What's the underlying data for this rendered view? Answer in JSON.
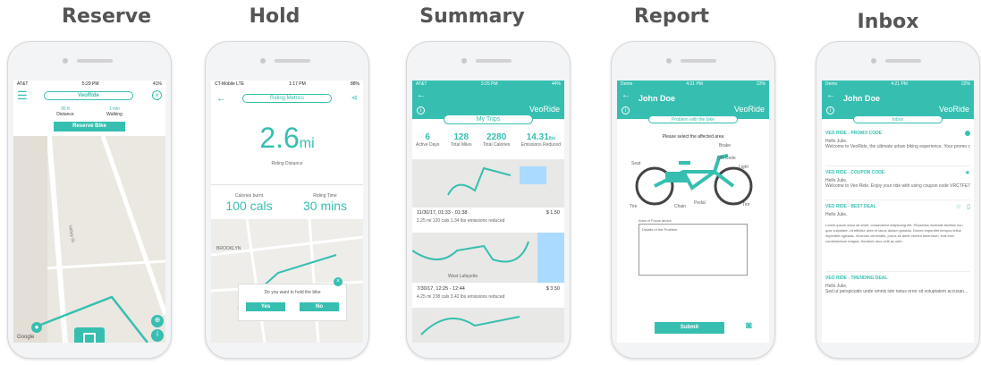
{
  "titles": {
    "reserve": "Reserve",
    "hold": "Hold",
    "summary": "Summary",
    "report": "Report",
    "inbox": "Inbox"
  },
  "reserve": {
    "carrier": "AT&T",
    "time": "5:29 PM",
    "battery": "41%",
    "app": "VeoRide",
    "distance": "95 ft",
    "distance_label": "Distance",
    "walking": "1 min",
    "walking_label": "Walking",
    "button": "Reserve Bike",
    "street": "Valley St",
    "google": "Google"
  },
  "hold": {
    "carrier": "CT-Mobile LTE",
    "time": "1:17 PM",
    "battery": "88%",
    "header": "Riding Metrics",
    "value": "2.6",
    "unit": "mi",
    "label": "Riding Distance",
    "cal_label": "Calories burnt",
    "cal": "100 cals",
    "time_label": "Riding Time",
    "ride_time": "30 mins",
    "place": "BROOKLYN",
    "prompt": "Do you want to hold the bike",
    "yes": "Yes",
    "no": "No"
  },
  "summary": {
    "carrier": "AT&T",
    "time": "3:25 PM",
    "battery": "44%",
    "brand": "VeoRide",
    "tab": "My Trips",
    "stats": [
      {
        "v": "6",
        "l": "Active Days"
      },
      {
        "v": "128",
        "l": "Total Miles"
      },
      {
        "v": "2280",
        "l": "Total Calories"
      },
      {
        "v": "14.31",
        "u": "lbs",
        "l": "Emissions Reduced"
      }
    ],
    "trips": [
      {
        "date": "11/30/17, 01:33 - 01:38",
        "price": "$ 1.50",
        "detail": "2.25 mi   120 cals   1.34 lbs emissions reduced"
      },
      {
        "date": "7/30/17, 12:25 - 12:44",
        "price": "$ 3.50",
        "detail": "4.25 mi   238 cals   3.42 lbs emissions reduced"
      }
    ],
    "map_label": "West Lafayette"
  },
  "report": {
    "carrier": "Demo",
    "time": "4:21 PM",
    "battery": "22%",
    "user": "John Doe",
    "brand": "VeoRide",
    "tab": "Problem with the bike",
    "instruction": "Please select the affected area",
    "parts": [
      "Brake",
      "Seat",
      "QR Code",
      "Light",
      "Tire",
      "Pedal",
      "Chain",
      "Tire"
    ],
    "area_label": "Area of Focus above",
    "placeholder": "Details of the Problem",
    "submit": "Submit"
  },
  "inbox": {
    "carrier": "Demo",
    "time": "4:21 PM",
    "battery": "22%",
    "user": "John Doe",
    "brand": "VeoRide",
    "tab": "Inbox",
    "messages": [
      {
        "title": "VEO RIDE - PROMO CODE",
        "hello": "Hello Julie,",
        "body": "Welcome to VeoRide, the ultimate urban biking experience. Your promo code is...",
        "flag": "dot"
      },
      {
        "title": "VEO RIDE - COUPON CODE",
        "hello": "Hello Julie,",
        "body": "Welcome to Veo Ride. Enjoy your ride with using coupon code VRCTFE7...",
        "flag": "star"
      },
      {
        "title": "VEO RIDE - BEST DEAL",
        "hello": "Hello Julie,",
        "body": "Lorem ipsum dolor sit amet, consectetur adipiscing elit. Phasellus molestie facilisis non quis vulputate. Ut efficitur ante et lacus dictum gravida. Donec imperdiet tempus tellus imperdiet egestas. Vivamus venenatis, purus sit amet viverra bibendum, erat erat condimentum magna, tincidunt arcu velit ac odio.",
        "flag": "star-outline"
      },
      {
        "title": "VEO RIDE - TRENDING DEAL",
        "hello": "Hello Julie,",
        "body": "Sed ut perspiciatis unde omnis iste natus error sit voluptatem accusan...",
        "flag": ""
      }
    ]
  },
  "colors": {
    "accent": "#36bfb1"
  }
}
